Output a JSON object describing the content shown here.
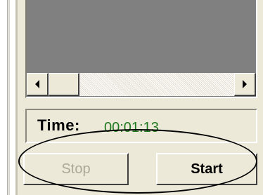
{
  "time": {
    "label": "Time:",
    "value": "00:01:13"
  },
  "buttons": {
    "stop_label": "Stop",
    "start_label": "Start"
  },
  "icons": {
    "scroll_left": "arrow-left-icon",
    "scroll_right": "arrow-right-icon"
  },
  "colors": {
    "time_value": "#1f7a1f",
    "disabled_text": "#aca899",
    "dialog_bg": "#ece9d8",
    "preview_bg": "#808080"
  }
}
